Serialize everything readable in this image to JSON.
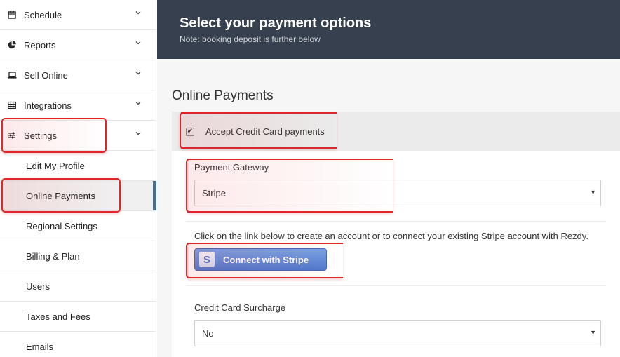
{
  "sidebar": {
    "items": [
      {
        "label": "Schedule",
        "icon": "calendar-icon"
      },
      {
        "label": "Reports",
        "icon": "pie-chart-icon"
      },
      {
        "label": "Sell Online",
        "icon": "laptop-icon"
      },
      {
        "label": "Integrations",
        "icon": "grid-icon"
      },
      {
        "label": "Settings",
        "icon": "sliders-icon"
      }
    ],
    "sub_items": [
      {
        "label": "Edit My Profile"
      },
      {
        "label": "Online Payments"
      },
      {
        "label": "Regional Settings"
      },
      {
        "label": "Billing & Plan"
      },
      {
        "label": "Users"
      },
      {
        "label": "Taxes and Fees"
      },
      {
        "label": "Emails"
      }
    ],
    "active_item": "Online Payments"
  },
  "header": {
    "title": "Select your payment options",
    "subtitle": "Note: booking deposit is further below"
  },
  "main": {
    "section_title": "Online Payments",
    "accept_cc": {
      "label": "Accept Credit Card payments",
      "checked": true
    },
    "gateway": {
      "label": "Payment Gateway",
      "value": "Stripe"
    },
    "helper_text": "Click on the link below to create an account or to connect your existing Stripe account with Rezdy.",
    "stripe_button": {
      "label": "Connect with Stripe",
      "icon_letter": "S"
    },
    "surcharge": {
      "label": "Credit Card Surcharge",
      "value": "No"
    }
  },
  "colors": {
    "header_bg": "#37404f",
    "active_indicator": "#4a6f8d",
    "highlight": "#e0262b",
    "stripe_button": "#5a82d4"
  }
}
